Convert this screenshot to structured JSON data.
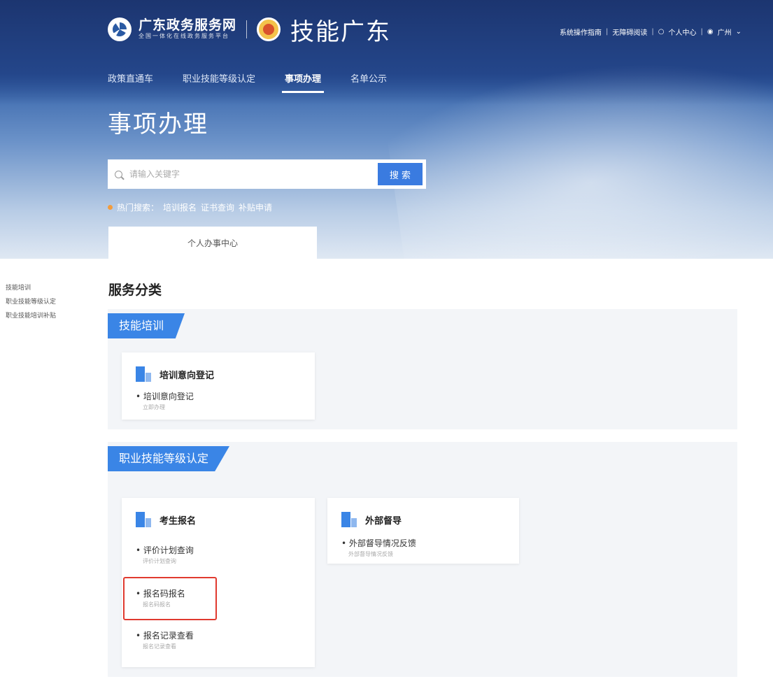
{
  "header": {
    "gov_title": "广东政务服务网",
    "gov_subtitle": "全国一体化在线政务服务平台",
    "brand": "技能广东",
    "top_links": [
      "系统操作指南",
      "无障碍阅读",
      "个人中心",
      "广州"
    ]
  },
  "nav": [
    "政策直通车",
    "职业技能等级认定",
    "事项办理",
    "名单公示"
  ],
  "page_title": "事项办理",
  "search": {
    "placeholder": "请输入关键字",
    "button": "搜 索"
  },
  "hot_search": {
    "label": "热门搜索：",
    "items": [
      "培训报名",
      "证书查询",
      "补贴申请"
    ]
  },
  "personal_tab": "个人办事中心",
  "side_nav": [
    "技能培训",
    "职业技能等级认定",
    "职业技能培训补贴"
  ],
  "section_heading": "服务分类",
  "categories": [
    {
      "tag": "技能培训",
      "cards": [
        {
          "title": "培训意向登记",
          "items": [
            {
              "name": "培训意向登记",
              "sub": "立即办理"
            }
          ]
        }
      ]
    },
    {
      "tag": "职业技能等级认定",
      "cards": [
        {
          "title": "考生报名",
          "items": [
            {
              "name": "评价计划查询",
              "sub": "评价计划查询"
            },
            {
              "name": "报名码报名",
              "sub": "报名码报名"
            },
            {
              "name": "报名记录查看",
              "sub": "报名记录查看"
            }
          ]
        },
        {
          "title": "外部督导",
          "items": [
            {
              "name": "外部督导情况反馈",
              "sub": "外部督导情况反馈"
            }
          ]
        }
      ]
    }
  ],
  "colors": {
    "accent": "#3a85e6",
    "highlight": "#e03a2f",
    "banner": "#24468a"
  }
}
